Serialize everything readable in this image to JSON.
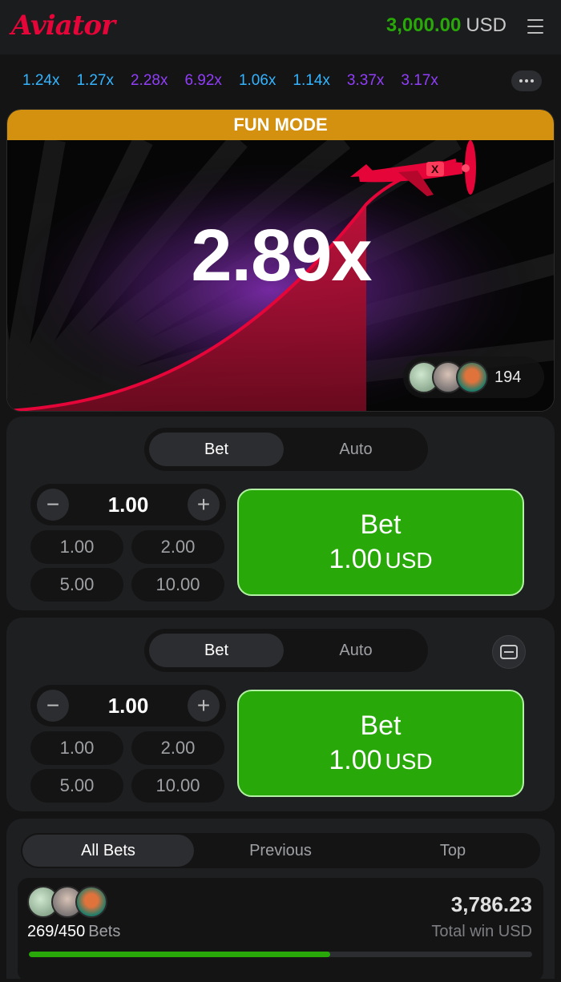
{
  "header": {
    "logo": "Aviator",
    "balance_amount": "3,000.00",
    "balance_currency": "USD"
  },
  "history": {
    "items": [
      {
        "value": "1.24x",
        "tone": "blue"
      },
      {
        "value": "1.27x",
        "tone": "blue"
      },
      {
        "value": "2.28x",
        "tone": "purple"
      },
      {
        "value": "6.92x",
        "tone": "purple"
      },
      {
        "value": "1.06x",
        "tone": "blue"
      },
      {
        "value": "1.14x",
        "tone": "blue"
      },
      {
        "value": "3.37x",
        "tone": "purple"
      },
      {
        "value": "3.17x",
        "tone": "purple"
      }
    ]
  },
  "game": {
    "mode_label": "FUN MODE",
    "multiplier": "2.89x",
    "player_count": "194"
  },
  "bet_panels": [
    {
      "tab_bet": "Bet",
      "tab_auto": "Auto",
      "stake": "1.00",
      "quick_amounts": [
        "1.00",
        "2.00",
        "5.00",
        "10.00"
      ],
      "button_label": "Bet",
      "button_amount": "1.00",
      "button_currency": "USD"
    },
    {
      "tab_bet": "Bet",
      "tab_auto": "Auto",
      "stake": "1.00",
      "quick_amounts": [
        "1.00",
        "2.00",
        "5.00",
        "10.00"
      ],
      "button_label": "Bet",
      "button_amount": "1.00",
      "button_currency": "USD"
    }
  ],
  "bets_list": {
    "tabs": [
      "All Bets",
      "Previous",
      "Top"
    ],
    "bets_count": "269/450",
    "bets_label": "Bets",
    "total_win": "3,786.23",
    "total_win_label": "Total win USD",
    "progress_fraction": 0.598
  },
  "colors": {
    "brand_red": "#e50539",
    "bet_green": "#28a909",
    "history_blue": "#34b4ff",
    "history_purple": "#913ef8",
    "fun_mode": "#d4900f"
  }
}
